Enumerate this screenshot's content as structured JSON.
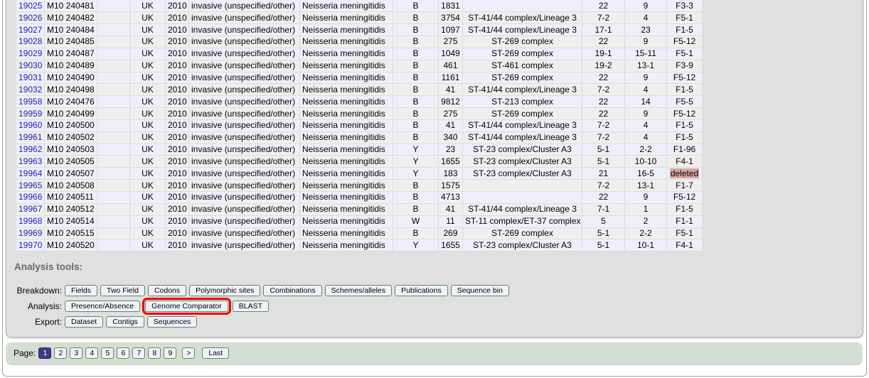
{
  "table": {
    "rows": [
      [
        "19025",
        "M10 240481",
        "",
        "UK",
        "2010",
        "invasive (unspecified/other)",
        "Neisseria meningitidis",
        "B",
        "1831",
        "",
        "22",
        "9",
        "F3-3"
      ],
      [
        "19026",
        "M10 240482",
        "",
        "UK",
        "2010",
        "invasive (unspecified/other)",
        "Neisseria meningitidis",
        "B",
        "3754",
        "ST-41/44 complex/Lineage 3",
        "7-2",
        "4",
        "F5-1"
      ],
      [
        "19027",
        "M10 240484",
        "",
        "UK",
        "2010",
        "invasive (unspecified/other)",
        "Neisseria meningitidis",
        "B",
        "1097",
        "ST-41/44 complex/Lineage 3",
        "17-1",
        "23",
        "F1-5"
      ],
      [
        "19028",
        "M10 240485",
        "",
        "UK",
        "2010",
        "invasive (unspecified/other)",
        "Neisseria meningitidis",
        "B",
        "275",
        "ST-269 complex",
        "22",
        "9",
        "F5-12"
      ],
      [
        "19029",
        "M10 240487",
        "",
        "UK",
        "2010",
        "invasive (unspecified/other)",
        "Neisseria meningitidis",
        "B",
        "1049",
        "ST-269 complex",
        "19-1",
        "15-11",
        "F5-1"
      ],
      [
        "19030",
        "M10 240489",
        "",
        "UK",
        "2010",
        "invasive (unspecified/other)",
        "Neisseria meningitidis",
        "B",
        "461",
        "ST-461 complex",
        "19-2",
        "13-1",
        "F3-9"
      ],
      [
        "19031",
        "M10 240490",
        "",
        "UK",
        "2010",
        "invasive (unspecified/other)",
        "Neisseria meningitidis",
        "B",
        "1161",
        "ST-269 complex",
        "22",
        "9",
        "F5-12"
      ],
      [
        "19032",
        "M10 240498",
        "",
        "UK",
        "2010",
        "invasive (unspecified/other)",
        "Neisseria meningitidis",
        "B",
        "41",
        "ST-41/44 complex/Lineage 3",
        "7-2",
        "4",
        "F1-5"
      ],
      [
        "19958",
        "M10 240476",
        "",
        "UK",
        "2010",
        "invasive (unspecified/other)",
        "Neisseria meningitidis",
        "B",
        "9812",
        "ST-213 complex",
        "22",
        "14",
        "F5-5"
      ],
      [
        "19959",
        "M10 240499",
        "",
        "UK",
        "2010",
        "invasive (unspecified/other)",
        "Neisseria meningitidis",
        "B",
        "275",
        "ST-269 complex",
        "22",
        "9",
        "F5-12"
      ],
      [
        "19960",
        "M10 240500",
        "",
        "UK",
        "2010",
        "invasive (unspecified/other)",
        "Neisseria meningitidis",
        "B",
        "41",
        "ST-41/44 complex/Lineage 3",
        "7-2",
        "4",
        "F1-5"
      ],
      [
        "19961",
        "M10 240502",
        "",
        "UK",
        "2010",
        "invasive (unspecified/other)",
        "Neisseria meningitidis",
        "B",
        "340",
        "ST-41/44 complex/Lineage 3",
        "7-2",
        "4",
        "F1-5"
      ],
      [
        "19962",
        "M10 240503",
        "",
        "UK",
        "2010",
        "invasive (unspecified/other)",
        "Neisseria meningitidis",
        "Y",
        "23",
        "ST-23 complex/Cluster A3",
        "5-1",
        "2-2",
        "F1-96"
      ],
      [
        "19963",
        "M10 240505",
        "",
        "UK",
        "2010",
        "invasive (unspecified/other)",
        "Neisseria meningitidis",
        "Y",
        "1655",
        "ST-23 complex/Cluster A3",
        "5-1",
        "10-10",
        "F4-1"
      ],
      [
        "19964",
        "M10 240507",
        "",
        "UK",
        "2010",
        "invasive (unspecified/other)",
        "Neisseria meningitidis",
        "Y",
        "183",
        "ST-23 complex/Cluster A3",
        "21",
        "16-5",
        "deleted"
      ],
      [
        "19965",
        "M10 240508",
        "",
        "UK",
        "2010",
        "invasive (unspecified/other)",
        "Neisseria meningitidis",
        "B",
        "1575",
        "",
        "7-2",
        "13-1",
        "F1-7"
      ],
      [
        "19966",
        "M10 240511",
        "",
        "UK",
        "2010",
        "invasive (unspecified/other)",
        "Neisseria meningitidis",
        "B",
        "4713",
        "",
        "22",
        "9",
        "F5-12"
      ],
      [
        "19967",
        "M10 240512",
        "",
        "UK",
        "2010",
        "invasive (unspecified/other)",
        "Neisseria meningitidis",
        "B",
        "41",
        "ST-41/44 complex/Lineage 3",
        "7-1",
        "1",
        "F1-5"
      ],
      [
        "19968",
        "M10 240514",
        "",
        "UK",
        "2010",
        "invasive (unspecified/other)",
        "Neisseria meningitidis",
        "W",
        "11",
        "ST-11 complex/ET-37 complex",
        "5",
        "2",
        "F1-1"
      ],
      [
        "19969",
        "M10 240515",
        "",
        "UK",
        "2010",
        "invasive (unspecified/other)",
        "Neisseria meningitidis",
        "B",
        "269",
        "ST-269 complex",
        "5-1",
        "2-2",
        "F5-1"
      ],
      [
        "19970",
        "M10 240520",
        "",
        "UK",
        "2010",
        "invasive (unspecified/other)",
        "Neisseria meningitidis",
        "Y",
        "1655",
        "ST-23 complex/Cluster A3",
        "5-1",
        "10-1",
        "F4-1"
      ]
    ]
  },
  "tools": {
    "heading": "Analysis tools:",
    "breakdown": {
      "label": "Breakdown:",
      "buttons": [
        "Fields",
        "Two Field",
        "Codons",
        "Polymorphic sites",
        "Combinations",
        "Schemes/alleles",
        "Publications",
        "Sequence bin"
      ]
    },
    "analysis": {
      "label": "Analysis:",
      "buttons": [
        "Presence/Absence",
        "Genome Comparator",
        "BLAST"
      ],
      "highlighted": "Genome Comparator"
    },
    "export": {
      "label": "Export:",
      "buttons": [
        "Dataset",
        "Contigs",
        "Sequences"
      ]
    }
  },
  "pager": {
    "label": "Page:",
    "pages": [
      "1",
      "2",
      "3",
      "4",
      "5",
      "6",
      "7",
      "8",
      "9"
    ],
    "current": "1",
    "next": ">",
    "last": "Last"
  },
  "colors": {
    "highlight": "#ee0000",
    "link": "#2020c0",
    "current_page": "#3c3c84",
    "deleted_bg": "#dca6a0"
  }
}
